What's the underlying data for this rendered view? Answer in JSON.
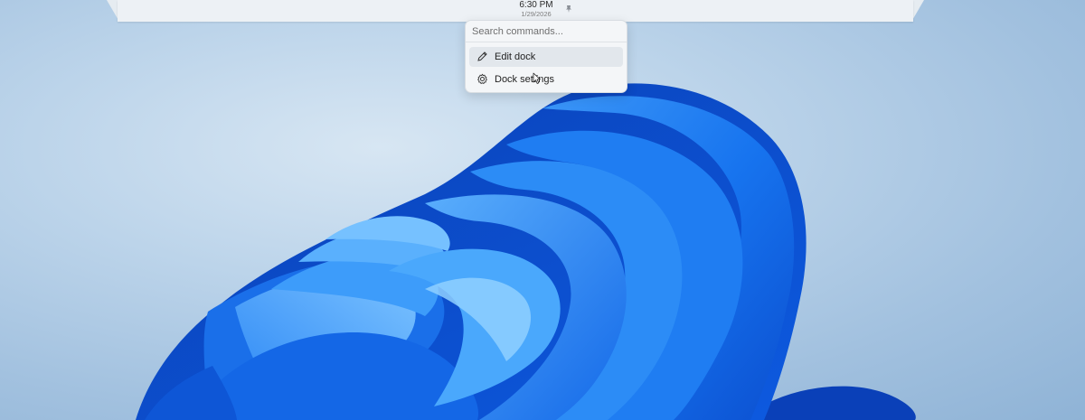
{
  "dock": {
    "clock_time": "6:30 PM",
    "clock_date": "1/29/2026",
    "pin_icon": "pin-icon"
  },
  "context_menu": {
    "search_placeholder": "Search commands...",
    "items": [
      {
        "label": "Edit dock",
        "icon": "pencil-icon"
      },
      {
        "label": "Dock settings",
        "icon": "gear-icon"
      }
    ]
  },
  "colors": {
    "dock_background": "#edf1f5",
    "menu_background": "#f4f6f8",
    "wallpaper_background": "#b9d2ea",
    "bloom_blue": "#1a6ee8"
  }
}
